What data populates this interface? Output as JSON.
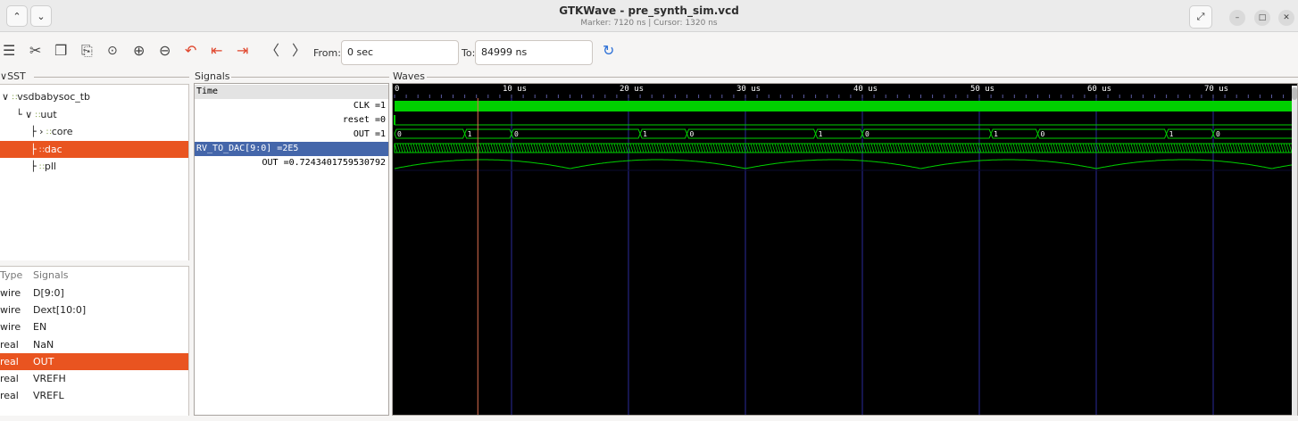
{
  "window": {
    "title": "GTKWave - pre_synth_sim.vcd",
    "subtitle": "Marker: 7120 ns  |  Cursor: 1320 ns"
  },
  "toolbar": {
    "from_label": "From:",
    "from_value": "0 sec",
    "to_label": "To:",
    "to_value": "84999 ns"
  },
  "sst": {
    "label": "SST",
    "tree": [
      {
        "label": "vsdbabysoc_tb",
        "prefix": "∨",
        "indent": 0
      },
      {
        "label": "uut",
        "prefix": "∨",
        "indent": 1
      },
      {
        "label": "core",
        "prefix": "›",
        "indent": 2
      },
      {
        "label": "dac",
        "prefix": "",
        "indent": 2,
        "selected": true
      },
      {
        "label": "pll",
        "prefix": "",
        "indent": 2
      }
    ]
  },
  "signal_list": {
    "type_header": "Type",
    "signals_header": "Signals",
    "rows": [
      {
        "type": "wire",
        "name": "D[9:0]"
      },
      {
        "type": "wire",
        "name": "Dext[10:0]"
      },
      {
        "type": "wire",
        "name": "EN"
      },
      {
        "type": "real",
        "name": "NaN"
      },
      {
        "type": "real",
        "name": "OUT",
        "selected": true
      },
      {
        "type": "real",
        "name": "VREFH"
      },
      {
        "type": "real",
        "name": "VREFL"
      }
    ]
  },
  "signals_pane": {
    "label": "Signals",
    "rows": [
      {
        "text": "Time",
        "kind": "time"
      },
      {
        "text": "CLK =1",
        "kind": "right"
      },
      {
        "text": "reset =0",
        "kind": "right"
      },
      {
        "text": "OUT =1",
        "kind": "right"
      },
      {
        "text": "RV_TO_DAC[9:0] =2E5",
        "kind": "highlight"
      },
      {
        "text": "OUT =0.7243401759530792",
        "kind": "right"
      }
    ]
  },
  "waves": {
    "label": "Waves",
    "time_labels": [
      "0",
      "10 us",
      "20 us",
      "30 us",
      "40 us",
      "50 us",
      "60 us",
      "70 us"
    ],
    "out_bus_values": [
      "0",
      "1",
      "0",
      "1",
      "0",
      "1",
      "0",
      "1",
      "0",
      "1",
      "0"
    ],
    "cursor_ns": 7120,
    "colors": {
      "background": "#000000",
      "trace": "#00d000",
      "grid": "#2a2a9a",
      "cursor": "#e07050",
      "time_text": "#ffffff"
    }
  }
}
